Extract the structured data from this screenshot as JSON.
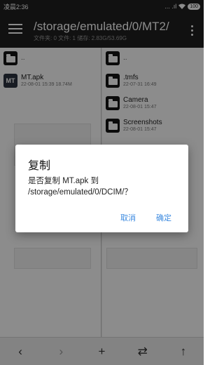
{
  "status_bar": {
    "time": "凌晨2:36",
    "signal": "... .ıl",
    "wifi": "wifi-icon",
    "battery": "100"
  },
  "app_bar": {
    "path": "/storage/emulated/0/MT2/",
    "summary": "文件夹: 0  文件: 1  储存: 2.83G/53.69G"
  },
  "left_pane": {
    "items": [
      {
        "name": "..",
        "meta": ""
      },
      {
        "name": "MT.apk",
        "meta": "22-08-01 15:39  18.74M"
      }
    ]
  },
  "right_pane": {
    "items": [
      {
        "name": "..",
        "meta": ""
      },
      {
        "name": ".tmfs",
        "meta": "22-07-31 16:49"
      },
      {
        "name": "Camera",
        "meta": "22-08-01 15:47"
      },
      {
        "name": "Screenshots",
        "meta": "22-08-01 15:47"
      }
    ]
  },
  "toolbar": {
    "back": "‹",
    "forward": "›",
    "add": "+",
    "swap": "⇄",
    "up": "↑"
  },
  "dialog": {
    "title": "复制",
    "message": "是否复制 MT.apk 到 /storage/emulated/0/DCIM/？",
    "cancel": "取消",
    "confirm": "确定"
  },
  "colors": {
    "accent": "#3d8be0",
    "appbar": "#1f1f1f"
  }
}
